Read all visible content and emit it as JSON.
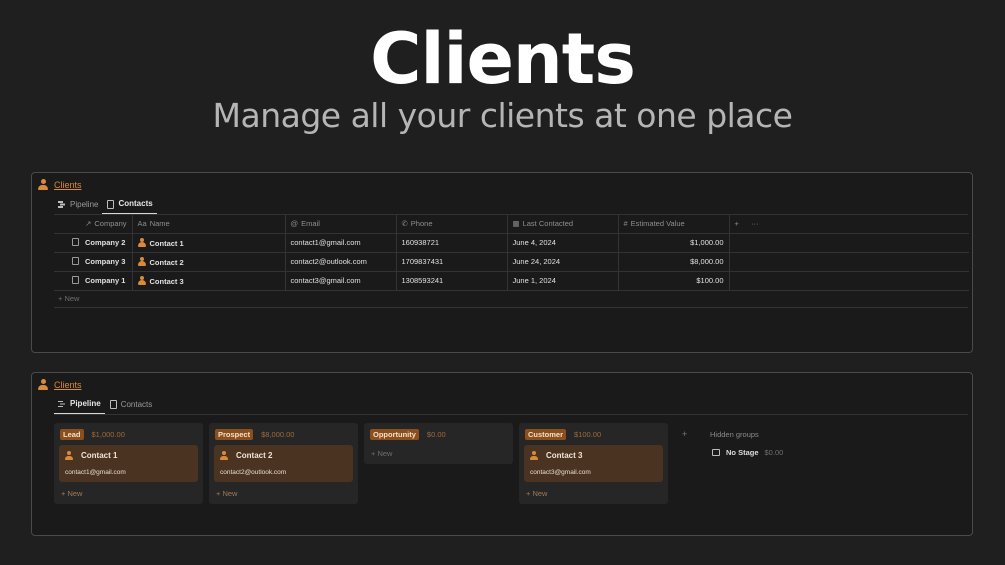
{
  "hero": {
    "title": "Clients",
    "subtitle": "Manage all your clients at one place"
  },
  "colors": {
    "accent": "#d98a3a",
    "pill": "#8a4f1c",
    "card": "#4a3320",
    "background": "#1f1f1f"
  },
  "table_view": {
    "title": "Clients",
    "tabs": [
      {
        "label": "Pipeline",
        "icon": "board-icon",
        "active": false
      },
      {
        "label": "Contacts",
        "icon": "document-icon",
        "active": true
      }
    ],
    "columns": [
      {
        "label": "Company",
        "icon": "↗"
      },
      {
        "label": "Name",
        "icon": "Aa"
      },
      {
        "label": "Email",
        "icon": "@"
      },
      {
        "label": "Phone",
        "icon": "✆"
      },
      {
        "label": "Last Contacted",
        "icon": "▦"
      },
      {
        "label": "Estimated Value",
        "icon": "#"
      }
    ],
    "add_column": "+",
    "more": "···",
    "rows": [
      {
        "company": "Company 2",
        "name": "Contact 1",
        "email": "contact1@gmail.com",
        "phone": "160938721",
        "last_contacted": "June 4, 2024",
        "value": "$1,000.00"
      },
      {
        "company": "Company 3",
        "name": "Contact 2",
        "email": "contact2@outlook.com",
        "phone": "1709837431",
        "last_contacted": "June 24, 2024",
        "value": "$8,000.00"
      },
      {
        "company": "Company 1",
        "name": "Contact 3",
        "email": "contact3@gmail.com",
        "phone": "1308593241",
        "last_contacted": "June 1, 2024",
        "value": "$100.00"
      }
    ],
    "new_label": "+  New"
  },
  "board_view": {
    "title": "Clients",
    "tabs": [
      {
        "label": "Pipeline",
        "icon": "board-icon",
        "active": true
      },
      {
        "label": "Contacts",
        "icon": "document-icon",
        "active": false
      }
    ],
    "columns": [
      {
        "stage": "Lead",
        "total": "$1,000.00",
        "cards": [
          {
            "name": "Contact 1",
            "email": "contact1@gmail.com"
          }
        ],
        "new_label": "+  New"
      },
      {
        "stage": "Prospect",
        "total": "$8,000.00",
        "cards": [
          {
            "name": "Contact 2",
            "email": "contact2@outlook.com"
          }
        ],
        "new_label": "+  New"
      },
      {
        "stage": "Opportunity",
        "total": "$0.00",
        "cards": [],
        "new_label": "+  New"
      },
      {
        "stage": "Customer",
        "total": "$100.00",
        "cards": [
          {
            "name": "Contact 3",
            "email": "contact3@gmail.com"
          }
        ],
        "new_label": "+  New"
      }
    ],
    "add_group": "+",
    "hidden_groups_label": "Hidden groups",
    "no_stage_label": "No Stage",
    "no_stage_value": "$0.00"
  }
}
